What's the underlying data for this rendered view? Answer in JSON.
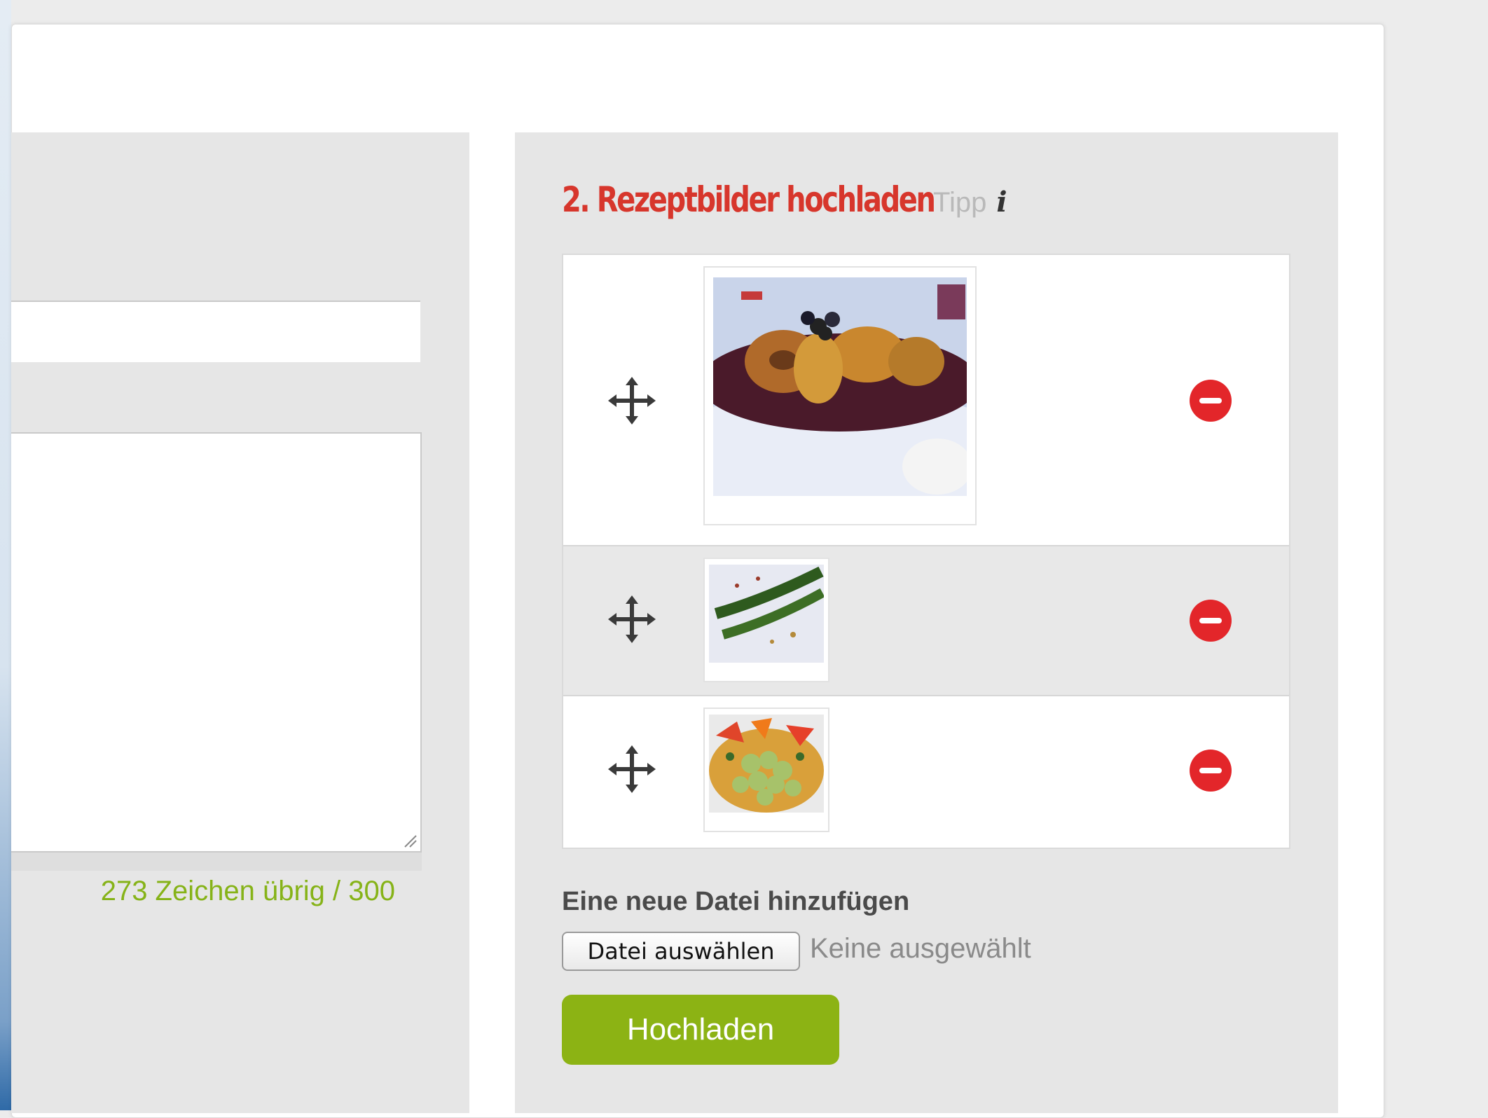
{
  "left": {
    "counter_text": "273 Zeichen übrig / 300"
  },
  "upload": {
    "title": "2. Rezeptbilder hochladen",
    "tip_label": "Tipp",
    "info_icon": "i",
    "images": [
      {
        "alt": "dessert-photo"
      },
      {
        "alt": "asparagus-photo"
      },
      {
        "alt": "grapes-salad-photo"
      }
    ],
    "add_file_label": "Eine neue Datei hinzufügen",
    "choose_file_button": "Datei auswählen",
    "file_status": "Keine ausgewählt",
    "upload_button": "Hochladen"
  },
  "colors": {
    "accent_red": "#d7362c",
    "accent_green": "#8cb314",
    "counter_green": "#86b318",
    "delete_red": "#e3262a"
  },
  "icons": [
    "move-icon",
    "remove-icon",
    "info-icon"
  ]
}
